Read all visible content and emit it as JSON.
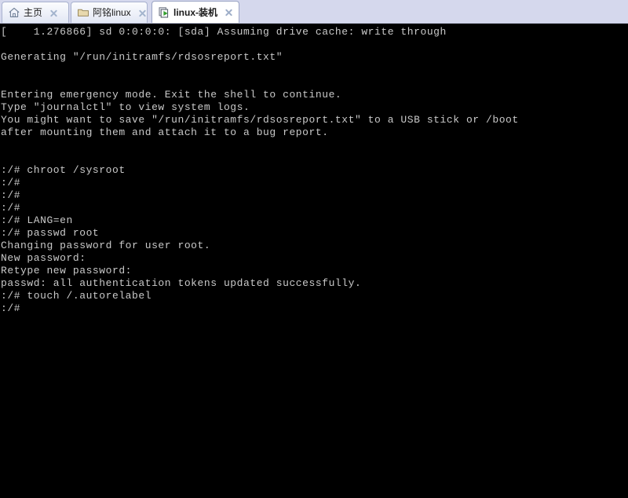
{
  "window": {
    "chrome_background": "#d5d8ed",
    "terminal_background": "#000000",
    "terminal_foreground": "#c9c9c9"
  },
  "tabs": [
    {
      "label": "主页",
      "icon": "home-icon",
      "active": false,
      "close_icon": "close-icon"
    },
    {
      "label": "阿铭linux",
      "icon": "folder-icon",
      "active": false,
      "close_icon": "close-icon"
    },
    {
      "label": "linux-装机",
      "icon": "session-run-icon",
      "active": true,
      "close_icon": "close-icon"
    }
  ],
  "terminal": {
    "lines": [
      "[    1.276866] sd 0:0:0:0: [sda] Assuming drive cache: write through",
      "",
      "Generating \"/run/initramfs/rdsosreport.txt\"",
      "",
      "",
      "Entering emergency mode. Exit the shell to continue.",
      "Type \"journalctl\" to view system logs.",
      "You might want to save \"/run/initramfs/rdsosreport.txt\" to a USB stick or /boot",
      "after mounting them and attach it to a bug report.",
      "",
      "",
      ":/# chroot /sysroot",
      ":/#",
      ":/#",
      ":/#",
      ":/# LANG=en",
      ":/# passwd root",
      "Changing password for user root.",
      "New password:",
      "Retype new password:",
      "passwd: all authentication tokens updated successfully.",
      ":/# touch /.autorelabel",
      ":/#"
    ]
  }
}
